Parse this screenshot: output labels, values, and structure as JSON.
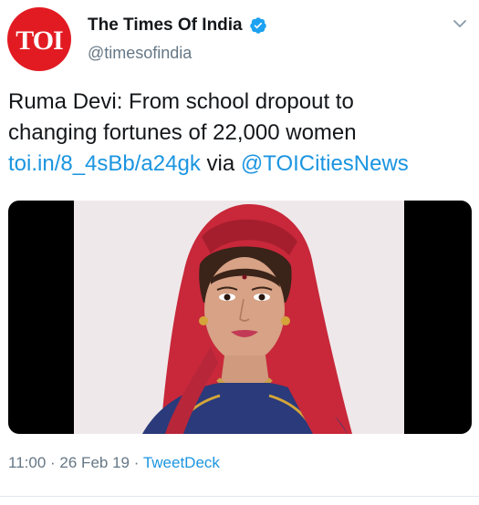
{
  "account": {
    "avatar_text": "TOI",
    "display_name": "The Times Of India",
    "handle": "@timesofindia",
    "verified_icon": "verified-badge-icon",
    "brand_color": "#e21b22"
  },
  "tweet": {
    "line1": "Ruma Devi: From school dropout to",
    "line2": "changing fortunes of 22,000 women",
    "link": "toi.in/8_4sBb/a24gk",
    "via_text": "via",
    "mention": "@TOICitiesNews"
  },
  "meta": {
    "time": "11:00",
    "sep1": "·",
    "date": "26 Feb 19",
    "sep2": "·",
    "source": "TweetDeck"
  },
  "colors": {
    "link": "#1b95e0",
    "muted": "#657786",
    "text": "#14171a"
  }
}
